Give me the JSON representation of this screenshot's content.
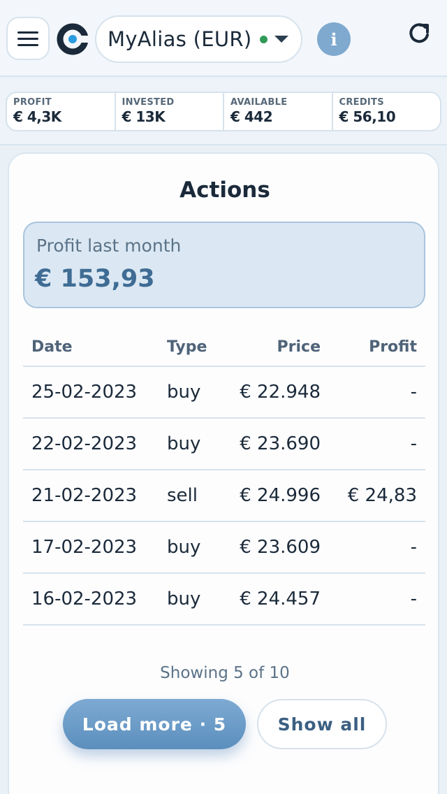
{
  "header": {
    "alias_label": "MyAlias (EUR)",
    "info_label": "i",
    "status_color": "#2e9a56",
    "icons": [
      "menu-icon",
      "logo-icon",
      "chevron-down-icon",
      "info-icon",
      "refresh-icon"
    ]
  },
  "stats": [
    {
      "label": "PROFIT",
      "value": "€ 4,3K"
    },
    {
      "label": "INVESTED",
      "value": "€ 13K"
    },
    {
      "label": "AVAILABLE",
      "value": "€ 442"
    },
    {
      "label": "CREDITS",
      "value": "€ 56,10"
    }
  ],
  "card": {
    "title": "Actions",
    "profit_last_month": {
      "label": "Profit last month",
      "value": "€ 153,93"
    },
    "table": {
      "headers": {
        "date": "Date",
        "type": "Type",
        "price": "Price",
        "profit": "Profit"
      },
      "rows": [
        {
          "date": "25-02-2023",
          "type": "buy",
          "price": "€ 22.948",
          "profit": "-"
        },
        {
          "date": "22-02-2023",
          "type": "buy",
          "price": "€ 23.690",
          "profit": "-"
        },
        {
          "date": "21-02-2023",
          "type": "sell",
          "price": "€ 24.996",
          "profit": "€ 24,83"
        },
        {
          "date": "17-02-2023",
          "type": "buy",
          "price": "€ 23.609",
          "profit": "-"
        },
        {
          "date": "16-02-2023",
          "type": "buy",
          "price": "€ 24.457",
          "profit": "-"
        }
      ]
    },
    "showing_text": "Showing 5 of 10",
    "load_more_label": "Load more · 5",
    "show_all_label": "Show all"
  },
  "colors": {
    "accent": "#6b9cc8",
    "text": "#1b2a3a"
  }
}
